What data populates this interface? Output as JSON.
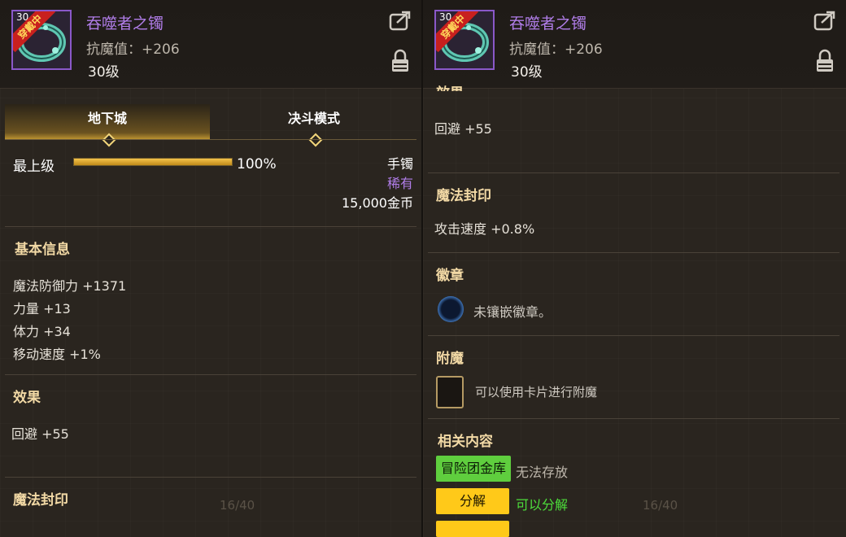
{
  "item": {
    "name": "吞噬者之镯",
    "stat_label": "抗魔值：",
    "stat_value": "+206",
    "level": "30级",
    "ribbon": "穿戴中",
    "icon_level": "30"
  },
  "tabs": [
    {
      "label": "地下城",
      "active": true
    },
    {
      "label": "决斗模式",
      "active": false
    }
  ],
  "grade": {
    "label": "最上级",
    "percent": "100%",
    "fill": 1.0
  },
  "meta": {
    "slot": "手镯",
    "rarity": "稀有",
    "price": "15,000金币"
  },
  "left": {
    "basic_title": "基本信息",
    "basic": [
      "魔法防御力 +1371",
      "力量 +13",
      "体力 +34",
      "移动速度 +1%"
    ],
    "effect_title": "效果",
    "effect": "回避 +55",
    "seal_title": "魔法封印",
    "footer_hint": "16/40"
  },
  "right": {
    "effect_title_partial": "效果",
    "effect": "回避 +55",
    "seal_title": "魔法封印",
    "seal": "攻击速度 +0.8%",
    "emblem_title": "徽章",
    "emblem_text": "未镶嵌徽章。",
    "enchant_title": "附魔",
    "enchant_text": "可以使用卡片进行附魔",
    "related_title": "相关内容",
    "related": [
      {
        "badge": "冒险团金库",
        "note": "无法存放",
        "style": "green"
      },
      {
        "badge": "分解",
        "note": "可以分解",
        "style": "yellow"
      }
    ],
    "footer_hint": "16/40"
  },
  "colors": {
    "accent_purple": "#b07de8",
    "gold": "#f2d9a5",
    "green": "#4dde3b",
    "yellow": "#ffc919"
  }
}
